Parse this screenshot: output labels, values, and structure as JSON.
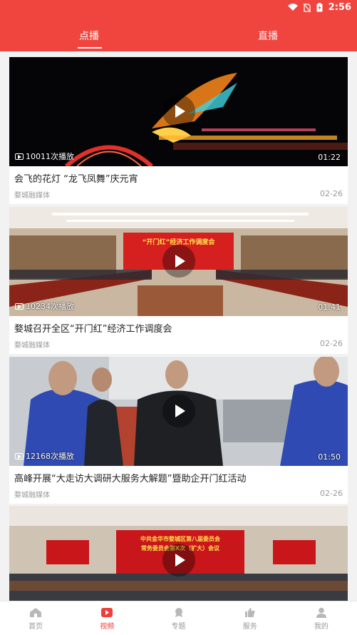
{
  "status": {
    "time": "2:56"
  },
  "tabs": {
    "active": "点播",
    "inactive": "直播"
  },
  "colors": {
    "brand": "#f0453f",
    "nav_active": "#ef3f3a"
  },
  "videos": [
    {
      "plays": "10011次播放",
      "duration": "01:22",
      "title": "会飞的花灯 “龙飞凤舞”庆元宵",
      "source": "婺城融媒体",
      "date": "02-26"
    },
    {
      "plays": "10234次播放",
      "duration": "01:41",
      "title": "婺城召开全区“开门红”经济工作调度会",
      "source": "婺城融媒体",
      "date": "02-26",
      "banner": "“开门红”经济工作调度会"
    },
    {
      "plays": "12168次播放",
      "duration": "01:50",
      "title": "高峰开展“大走访大调研大服务大解题”暨助企开门红活动",
      "source": "婺城融媒体",
      "date": "02-26"
    },
    {
      "banner_line1": "中共金华市婺城区第八届委员会",
      "banner_line2": "常务委员会第X次（扩大）会议"
    }
  ],
  "nav": [
    {
      "label": "首页",
      "icon": "home-icon"
    },
    {
      "label": "视频",
      "icon": "video-icon"
    },
    {
      "label": "专题",
      "icon": "topic-icon"
    },
    {
      "label": "服务",
      "icon": "thumbs-up-icon"
    },
    {
      "label": "我的",
      "icon": "user-icon"
    }
  ]
}
